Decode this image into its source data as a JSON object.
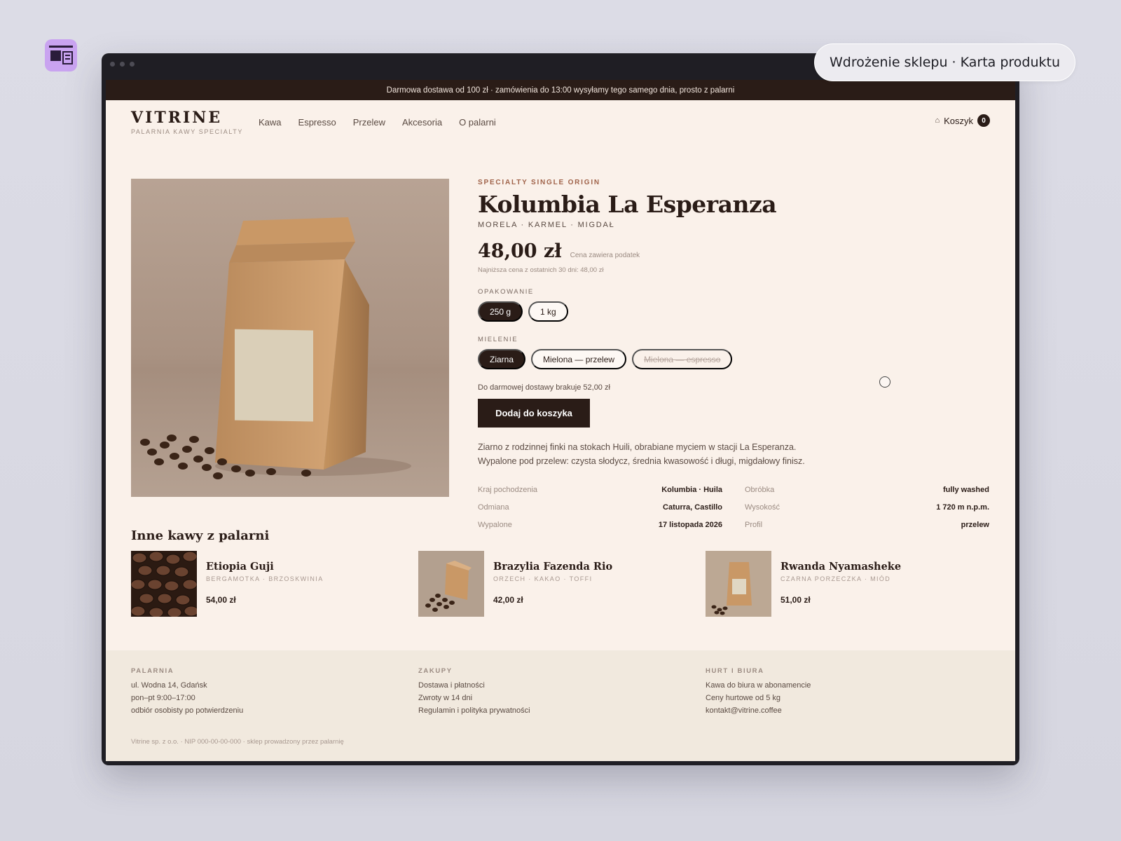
{
  "window": {
    "pill_label": "Wdrożenie sklepu · Karta produktu"
  },
  "topbar": {
    "text": "Darmowa dostawa od 100 zł · zamówienia do 13:00 wysyłamy tego samego dnia, prosto z palarni"
  },
  "header": {
    "logo_title": "VITRINE",
    "logo_subtitle": "PALARNIA KAWY SPECIALTY",
    "nav": [
      "Kawa",
      "Espresso",
      "Przelew",
      "Akcesoria",
      "O palarni"
    ],
    "cart_label": "Koszyk",
    "cart_count": "0"
  },
  "product": {
    "eyebrow": "SPECIALTY SINGLE ORIGIN",
    "title": "Kolumbia La Esperanza",
    "notes": "MORELA · KARMEL · MIGDAŁ",
    "price": "48,00 zł",
    "tax_note": "Cena zawiera podatek",
    "lowest_price": "Najniższa cena z ostatnich 30 dni: 48,00 zł",
    "packaging_label": "OPAKOWANIE",
    "packaging": [
      {
        "label": "250 g",
        "state": "active"
      },
      {
        "label": "1 kg",
        "state": "normal"
      }
    ],
    "grind_label": "MIELENIE",
    "grind": [
      {
        "label": "Ziarna",
        "state": "active"
      },
      {
        "label": "Mielona — przelew",
        "state": "normal"
      },
      {
        "label": "Mielona — espresso",
        "state": "disabled"
      }
    ],
    "shipping_note": "Do darmowej dostawy brakuje 52,00 zł",
    "add_to_cart": "Dodaj do koszyka",
    "description_1": "Ziarno z rodzinnej finki na stokach Huili, obrabiane myciem w stacji La Esperanza.",
    "description_2": "Wypalone pod przelew: czysta słodycz, średnia kwasowość i długi, migdałowy finisz.",
    "specs": [
      {
        "k": "Kraj pochodzenia",
        "v": "Kolumbia · Huila"
      },
      {
        "k": "Obróbka",
        "v": "fully washed"
      },
      {
        "k": "Odmiana",
        "v": "Caturra, Castillo"
      },
      {
        "k": "Wysokość",
        "v": "1 720 m n.p.m."
      },
      {
        "k": "Wypalone",
        "v": "17 listopada 2026"
      },
      {
        "k": "Profil",
        "v": "przelew"
      }
    ]
  },
  "related": {
    "title": "Inne kawy z palarni",
    "items": [
      {
        "name": "Etiopia Guji",
        "notes": "BERGAMOTKA · BRZOSKWINIA",
        "price": "54,00 zł"
      },
      {
        "name": "Brazylia Fazenda Rio",
        "notes": "ORZECH · KAKAO · TOFFI",
        "price": "42,00 zł"
      },
      {
        "name": "Rwanda Nyamasheke",
        "notes": "CZARNA PORZECZKA · MIÓD",
        "price": "51,00 zł"
      }
    ]
  },
  "footer": {
    "cols": [
      {
        "head": "PALARNIA",
        "lines": [
          "ul. Wodna 14, Gdańsk",
          "pon–pt 9:00–17:00",
          "odbiór osobisty po potwierdzeniu"
        ]
      },
      {
        "head": "ZAKUPY",
        "lines": [
          "Dostawa i płatności",
          "Zwroty w 14 dni",
          "Regulamin i polityka prywatności"
        ]
      },
      {
        "head": "HURT I BIURA",
        "lines": [
          "Kawa do biura w abonamencie",
          "Ceny hurtowe od 5 kg",
          "kontakt@vitrine.coffee"
        ]
      }
    ],
    "legal": "Vitrine sp. z o.o. · NIP 000-00-00-000 · sklep prowadzony przez palarnię"
  },
  "colors": {
    "accent": "#2a1c17",
    "eyebrow": "#a0634a",
    "background": "#faf1ea",
    "footer_bg": "#f1e9de"
  }
}
